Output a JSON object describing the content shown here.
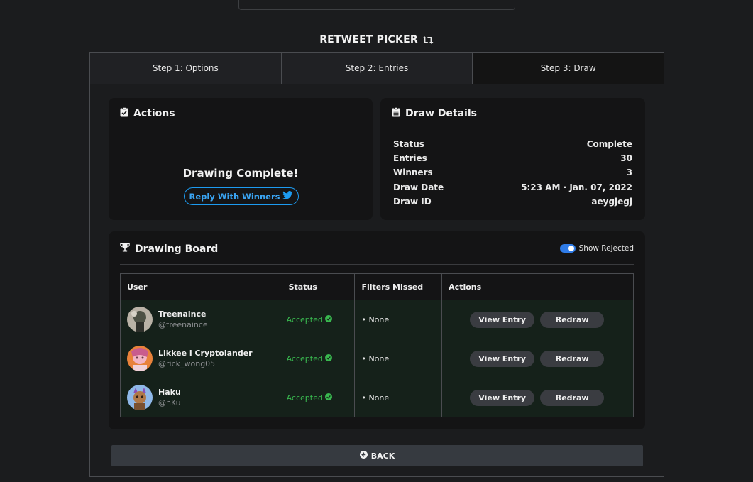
{
  "app": {
    "title": "RETWEET PICKER"
  },
  "tabs": [
    {
      "label": "Step 1: Options"
    },
    {
      "label": "Step 2: Entries"
    },
    {
      "label": "Step 3: Draw",
      "active": true
    }
  ],
  "actions_card": {
    "title": "Actions",
    "status_message": "Drawing Complete!",
    "reply_button": "Reply With Winners"
  },
  "details_card": {
    "title": "Draw Details",
    "rows": [
      {
        "label": "Status",
        "value": "Complete"
      },
      {
        "label": "Entries",
        "value": "30"
      },
      {
        "label": "Winners",
        "value": "3"
      },
      {
        "label": "Draw Date",
        "value": "5:23 AM · Jan. 07, 2022"
      },
      {
        "label": "Draw ID",
        "value": "aeygjegj"
      }
    ]
  },
  "board": {
    "title": "Drawing Board",
    "toggle_label": "Show Rejected",
    "toggle_on": true,
    "columns": [
      "User",
      "Status",
      "Filters Missed",
      "Actions"
    ],
    "rows": [
      {
        "name": "Treenaince",
        "handle": "@treenaince",
        "status": "Accepted",
        "filters": "• None",
        "view": "View Entry",
        "redraw": "Redraw"
      },
      {
        "name": "Likkee l Cryptolander",
        "handle": "@rick_wong05",
        "status": "Accepted",
        "filters": "• None",
        "view": "View Entry",
        "redraw": "Redraw"
      },
      {
        "name": "Haku",
        "handle": "@hKu",
        "status": "Accepted",
        "filters": "• None",
        "view": "View Entry",
        "redraw": "Redraw"
      }
    ]
  },
  "back_button": "BACK",
  "colors": {
    "accent_blue": "#1d9bf0",
    "accepted_green": "#39b84f",
    "toggle_blue": "#2f7ce8"
  }
}
